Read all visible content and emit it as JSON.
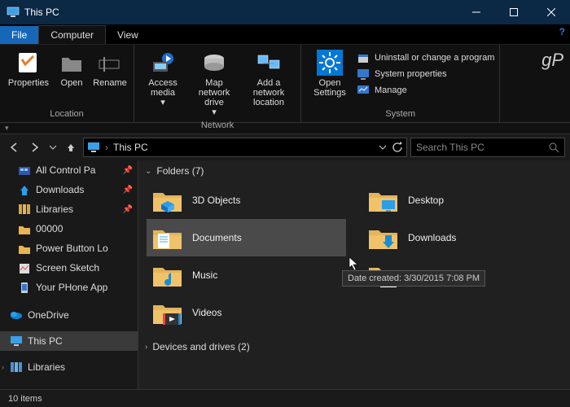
{
  "titlebar": {
    "title": "This PC"
  },
  "tabs": {
    "file": "File",
    "computer": "Computer",
    "view": "View"
  },
  "ribbon": {
    "location": {
      "label": "Location",
      "properties": "Properties",
      "open": "Open",
      "rename": "Rename"
    },
    "network": {
      "label": "Network",
      "access_media": "Access media",
      "map_drive": "Map network drive",
      "add_location": "Add a network location"
    },
    "system": {
      "label": "System",
      "open_settings": "Open Settings",
      "uninstall": "Uninstall or change a program",
      "properties": "System properties",
      "manage": "Manage"
    }
  },
  "addressbar": {
    "location": "This PC"
  },
  "search": {
    "placeholder": "Search This PC"
  },
  "nav": {
    "items": [
      {
        "label": "All Control Pa",
        "pinned": true
      },
      {
        "label": "Downloads",
        "pinned": true
      },
      {
        "label": "Libraries",
        "pinned": true
      },
      {
        "label": "00000"
      },
      {
        "label": "Power Button Lo"
      },
      {
        "label": "Screen Sketch"
      },
      {
        "label": "Your PHone App"
      }
    ],
    "onedrive": "OneDrive",
    "thispc": "This PC",
    "libraries": "Libraries"
  },
  "content": {
    "folders_header": "Folders (7)",
    "devices_header": "Devices and drives (2)",
    "folders": [
      {
        "label": "3D Objects"
      },
      {
        "label": "Desktop"
      },
      {
        "label": "Documents",
        "selected": true
      },
      {
        "label": "Downloads"
      },
      {
        "label": "Music"
      },
      {
        "label": "Pictures"
      },
      {
        "label": "Videos"
      }
    ],
    "tooltip": "Date created: 3/30/2015 7:08 PM"
  },
  "status": {
    "text": "10 items"
  },
  "watermark": "gP"
}
